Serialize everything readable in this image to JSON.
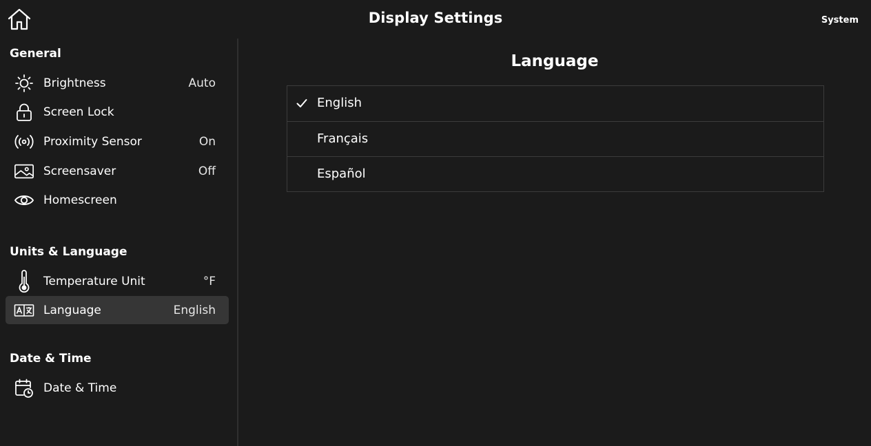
{
  "header": {
    "title": "Display Settings",
    "system_label": "System",
    "home_icon": "home-icon"
  },
  "sidebar": {
    "sections": [
      {
        "title": "General",
        "items": [
          {
            "label": "Brightness",
            "value": "Auto",
            "icon": "sun-icon"
          },
          {
            "label": "Screen Lock",
            "value": "",
            "icon": "lock-icon"
          },
          {
            "label": "Proximity Sensor",
            "value": "On",
            "icon": "proximity-icon"
          },
          {
            "label": "Screensaver",
            "value": "Off",
            "icon": "image-icon"
          },
          {
            "label": "Homescreen",
            "value": "",
            "icon": "eye-icon"
          }
        ]
      },
      {
        "title": "Units & Language",
        "items": [
          {
            "label": "Temperature Unit",
            "value": "°F",
            "icon": "thermometer-icon"
          },
          {
            "label": "Language",
            "value": "English",
            "icon": "translate-icon",
            "selected": true
          }
        ]
      },
      {
        "title": "Date & Time",
        "items": [
          {
            "label": "Date & Time",
            "value": "",
            "icon": "calendar-clock-icon"
          }
        ]
      }
    ]
  },
  "main": {
    "title": "Language",
    "options": [
      {
        "label": "English",
        "checked": true
      },
      {
        "label": "Français",
        "checked": false
      },
      {
        "label": "Español",
        "checked": false
      }
    ]
  },
  "colors": {
    "background": "#1b1b1b",
    "selected_row": "#363636",
    "divider": "#3c3c3c",
    "text": "#ffffff"
  }
}
